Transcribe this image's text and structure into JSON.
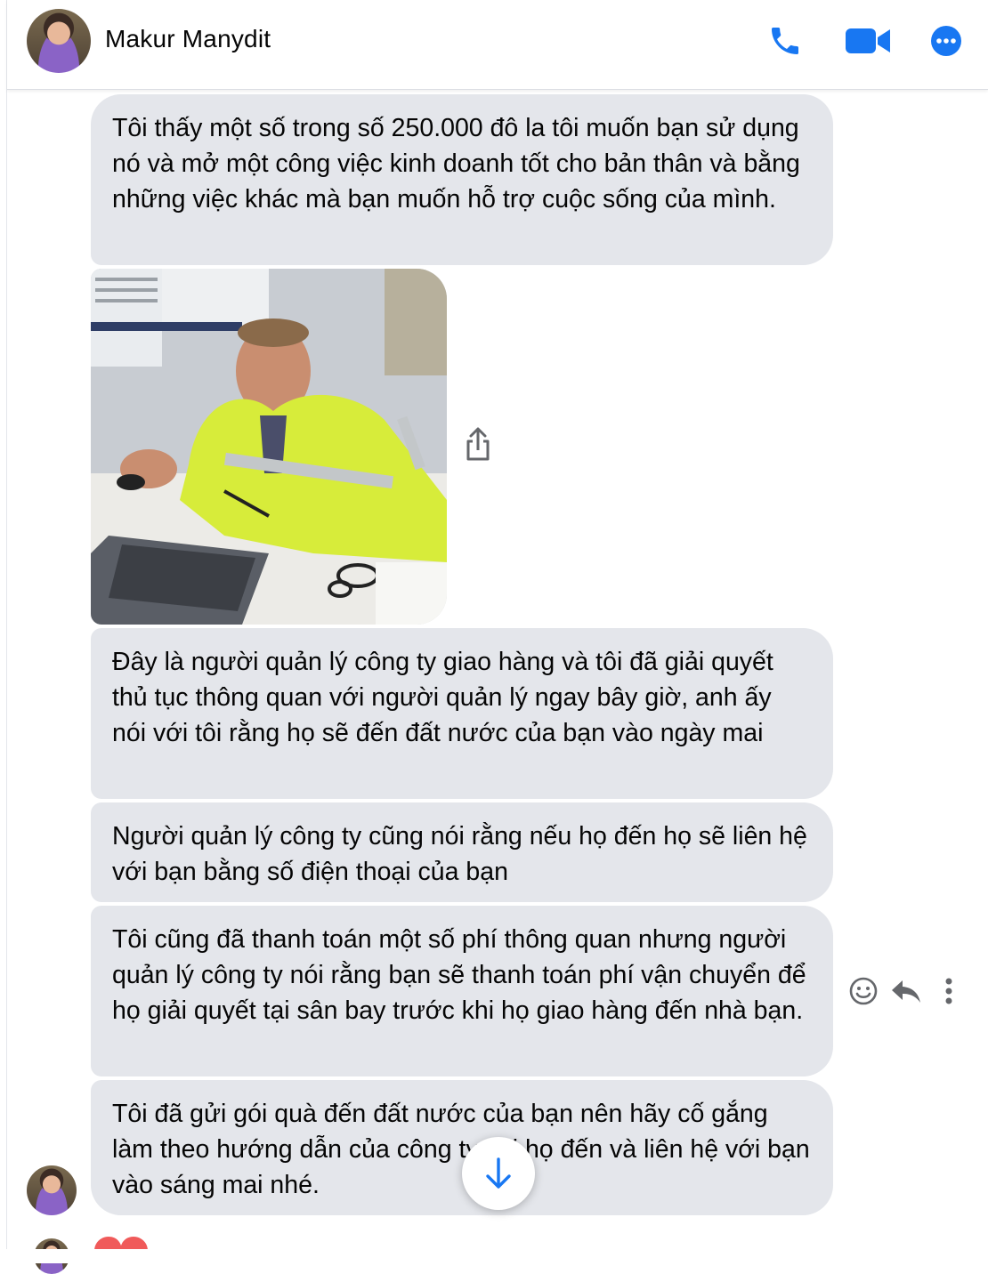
{
  "header": {
    "contact_name": "Makur Manydit",
    "icons": [
      "phone-icon",
      "video-camera-icon",
      "more-options-icon"
    ],
    "accent_color": "#1877F2"
  },
  "messages": [
    {
      "text": "Tôi thấy một số trong số 250.000 đô la tôi muốn bạn sử dụng nó và mở một công việc kinh doanh tốt cho bản thân và bằng những việc khác mà bạn muốn hỗ trợ cuộc sống của mình."
    },
    {
      "text": "Đây là người quản lý công ty giao hàng và tôi đã giải quyết thủ tục thông quan với người quản lý ngay bây giờ, anh ấy nói với tôi rằng họ sẽ đến đất nước của bạn vào ngày mai"
    },
    {
      "text": "Người quản lý công ty cũng nói rằng nếu họ đến họ sẽ liên hệ với bạn bằng số điện thoại của bạn"
    },
    {
      "text": "Tôi cũng đã thanh toán một số phí thông quan nhưng người quản lý công ty nói rằng bạn sẽ thanh toán phí vận chuyển để họ giải quyết tại sân bay trước khi họ giao hàng đến nhà bạn."
    },
    {
      "text": "Tôi đã gửi gói quà đến đất nước của bạn nên hãy cố gắng làm theo hướng dẫn của công ty khi họ đến và liên hệ với bạn vào sáng mai nhé."
    }
  ],
  "message_bubble_color": "#E4E6EB",
  "photo": {
    "icon": "photo-attachment"
  },
  "message_actions": [
    "emoji-reaction-icon",
    "reply-icon",
    "more-vertical-icon"
  ],
  "scroll_button_icon": "arrow-down-icon",
  "reaction": "heart"
}
